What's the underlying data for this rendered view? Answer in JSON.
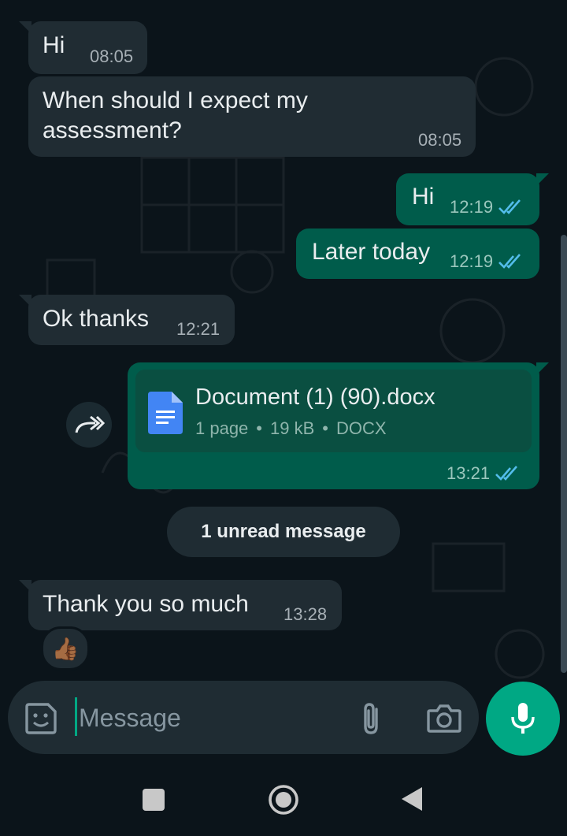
{
  "messages": [
    {
      "direction": "in",
      "text": "Hi",
      "time": "08:05"
    },
    {
      "direction": "in",
      "text": "When should I expect my\nassessment?",
      "time": "08:05"
    },
    {
      "direction": "out",
      "text": "Hi",
      "time": "12:19",
      "status": "read"
    },
    {
      "direction": "out",
      "text": "Later today",
      "time": "12:19",
      "status": "read"
    },
    {
      "direction": "in",
      "text": "Ok thanks",
      "time": "12:21"
    },
    {
      "direction": "out",
      "type": "document",
      "time": "13:21",
      "status": "read",
      "document": {
        "name": "Document (1) (90).docx",
        "pages": "1 page",
        "size": "19 kB",
        "kind": "DOCX"
      }
    },
    {
      "direction": "in",
      "text": "Thank you so much",
      "time": "13:28",
      "reaction": "👍🏾"
    }
  ],
  "unread_divider": "1 unread message",
  "input": {
    "placeholder": "Message"
  },
  "icons": {
    "sticker": "sticker-icon",
    "attach": "paperclip-icon",
    "camera": "camera-icon",
    "mic": "microphone-icon",
    "forward": "forward-icon",
    "document": "document-icon",
    "read": "double-check-icon",
    "nav": [
      "square-icon",
      "circle-icon",
      "back-triangle-icon"
    ]
  },
  "colors": {
    "incoming": "#202c33",
    "outgoing": "#005c4b",
    "accent": "#00a884",
    "read_ticks": "#53bdeb",
    "background": "#0b141a"
  }
}
